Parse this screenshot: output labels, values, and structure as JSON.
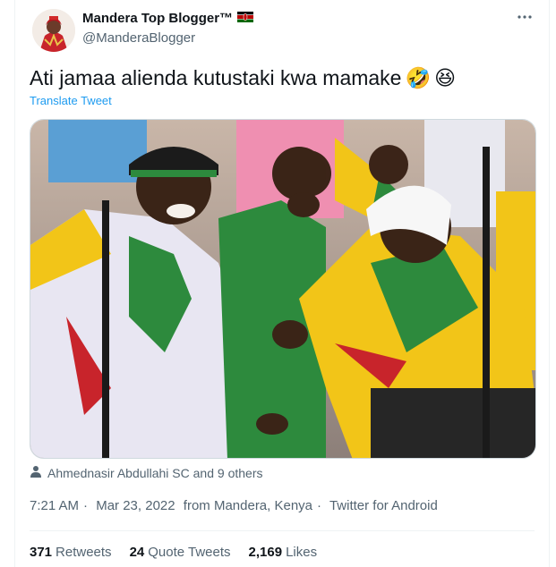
{
  "author": {
    "display_name": "Mandera Top Blogger™",
    "handle": "@ManderaBlogger",
    "flag_icon": "kenya-flag-icon"
  },
  "more_icon": "more-options-icon",
  "tweet": {
    "text": "Ati jamaa alienda kutustaki kwa mamake",
    "emojis": [
      "🤣",
      "😆"
    ],
    "translate_label": "Translate Tweet"
  },
  "tagged": {
    "icon": "person-icon",
    "text": "Ahmednasir Abdullahi SC and 9 others"
  },
  "meta": {
    "time": "7:21 AM",
    "date": "Mar 23, 2022",
    "location": "from Mandera, Kenya",
    "client": "Twitter for Android",
    "separator": "·"
  },
  "stats": {
    "retweets_count": "371",
    "retweets_label": "Retweets",
    "quotes_count": "24",
    "quotes_label": "Quote Tweets",
    "likes_count": "2,169",
    "likes_label": "Likes"
  },
  "colors": {
    "link_blue": "#1d9bf0",
    "secondary_text": "#536471",
    "primary_text": "#0f1419"
  }
}
